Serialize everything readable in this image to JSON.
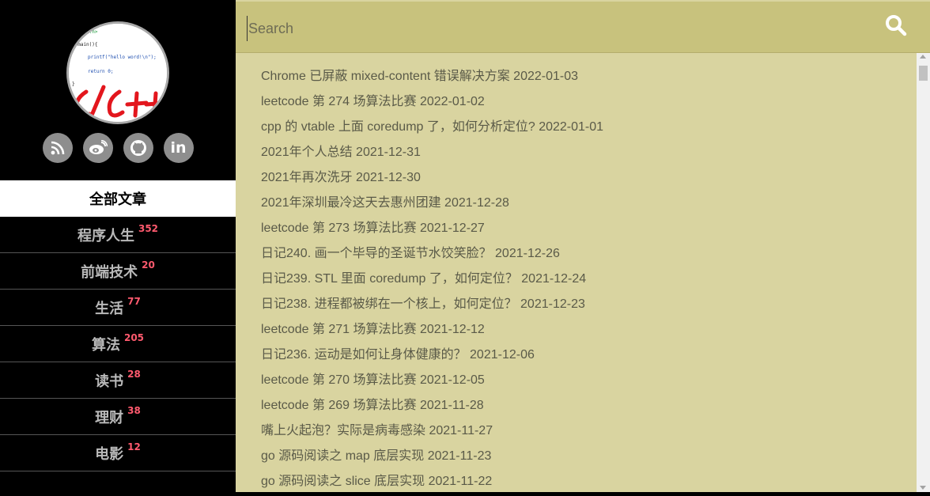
{
  "avatar": {
    "code_lines": [
      "<stdio.h>",
      "t main(){",
      "printf(\"hello word!\\n\");",
      "return 0;"
    ],
    "handwriting": "C/C++"
  },
  "social": [
    {
      "name": "rss-icon"
    },
    {
      "name": "weibo-icon"
    },
    {
      "name": "github-icon"
    },
    {
      "name": "linkedin-icon",
      "text": "in"
    }
  ],
  "nav": {
    "items": [
      {
        "label": "全部文章",
        "count": ""
      },
      {
        "label": "程序人生",
        "count": "352"
      },
      {
        "label": "前端技术",
        "count": "20"
      },
      {
        "label": "生活",
        "count": "77"
      },
      {
        "label": "算法",
        "count": "205"
      },
      {
        "label": "读书",
        "count": "28"
      },
      {
        "label": "理财",
        "count": "38"
      },
      {
        "label": "电影",
        "count": "12"
      }
    ],
    "active_index": 0
  },
  "search": {
    "placeholder": "Search",
    "value": ""
  },
  "posts": [
    "Chrome 已屏蔽 mixed-content 错误解决方案 2022-01-03",
    "leetcode 第 274 场算法比赛 2022-01-02",
    "cpp 的 vtable 上面 coredump 了，如何分析定位? 2022-01-01",
    "2021年个人总结 2021-12-31",
    "2021年再次洗牙 2021-12-30",
    "2021年深圳最冷这天去惠州团建 2021-12-28",
    "leetcode 第 273 场算法比赛 2021-12-27",
    "日记240. 画一个毕导的圣诞节水饺笑脸？ 2021-12-26",
    "日记239. STL 里面 coredump 了，如何定位？ 2021-12-24",
    "日记238. 进程都被绑在一个核上，如何定位？ 2021-12-23",
    "leetcode 第 271 场算法比赛 2021-12-12",
    "日记236. 运动是如何让身体健康的？ 2021-12-06",
    "leetcode 第 270 场算法比赛 2021-12-05",
    "leetcode 第 269 场算法比赛 2021-11-28",
    "嘴上火起泡？实际是病毒感染 2021-11-27",
    "go 源码阅读之 map 底层实现 2021-11-23",
    "go 源码阅读之 slice 底层实现 2021-11-22"
  ],
  "colors": {
    "sidebar_bg": "#000000",
    "main_bg": "#d9d4a0",
    "search_bg": "#c8c27d",
    "count_color": "#ff5a6e",
    "nav_text": "#b9b9b9"
  }
}
